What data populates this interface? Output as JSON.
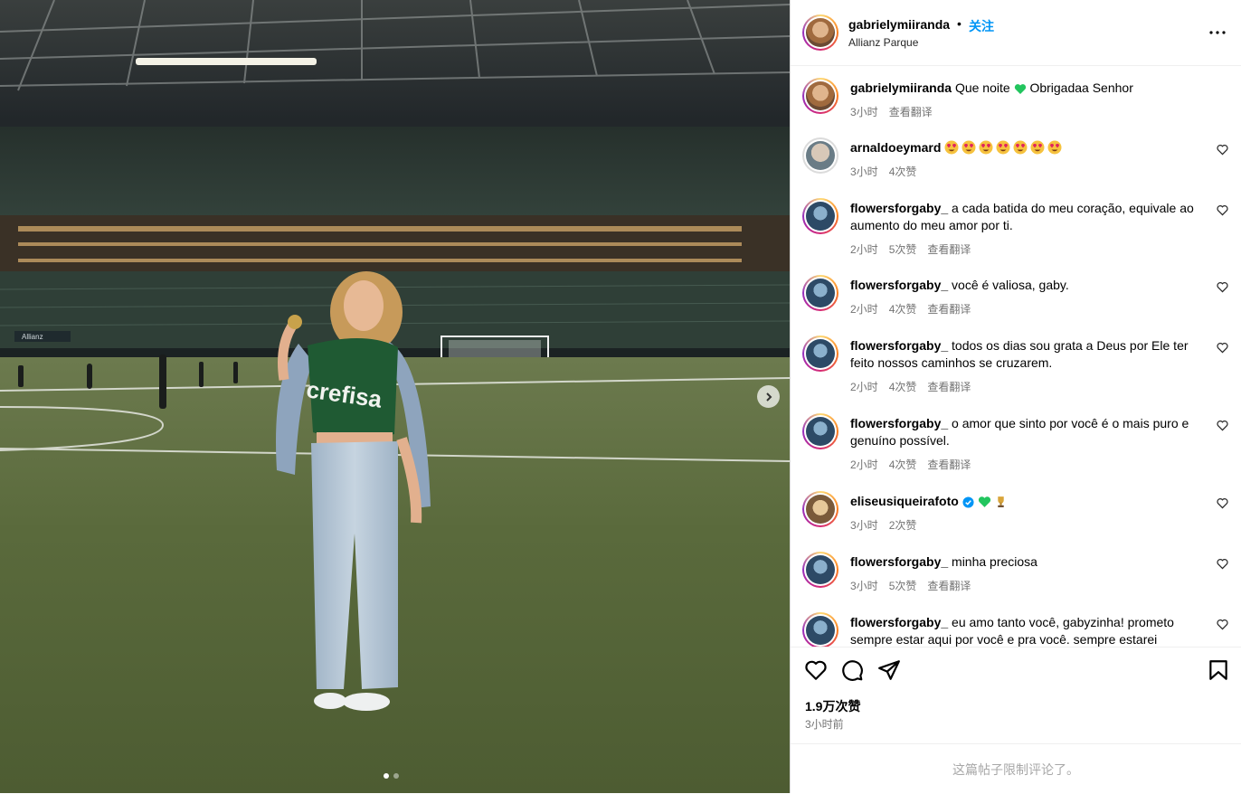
{
  "post": {
    "username": "gabrielymiiranda",
    "separator": "•",
    "follow_label": "关注",
    "location": "Allianz Parque",
    "likes": "1.9万次赞",
    "time": "3小时前",
    "restricted_notice": "这篇帖子限制评论了。"
  },
  "caption": {
    "username": "gabrielymiiranda",
    "text_a": "Que noite",
    "text_b": "Obrigadaa Senhor",
    "time": "3小时",
    "translate": "查看翻译"
  },
  "comments": [
    {
      "username": "arnaldoeymard",
      "text": "",
      "time": "3小时",
      "likes": "4次赞",
      "translate": ""
    },
    {
      "username": "flowersforgaby_",
      "text": "a cada batida do meu coração, equivale ao aumento do meu amor por ti.",
      "time": "2小时",
      "likes": "5次赞",
      "translate": "查看翻译"
    },
    {
      "username": "flowersforgaby_",
      "text": "você é valiosa, gaby.",
      "time": "2小时",
      "likes": "4次赞",
      "translate": "查看翻译"
    },
    {
      "username": "flowersforgaby_",
      "text": "todos os dias sou grata a Deus por Ele ter feito nossos caminhos se cruzarem.",
      "time": "2小时",
      "likes": "4次赞",
      "translate": "查看翻译"
    },
    {
      "username": "flowersforgaby_",
      "text": "o amor que sinto por você é o mais puro e genuíno possível.",
      "time": "2小时",
      "likes": "4次赞",
      "translate": "查看翻译"
    },
    {
      "username": "eliseusiqueirafoto",
      "text": "",
      "time": "3小时",
      "likes": "2次赞",
      "translate": ""
    },
    {
      "username": "flowersforgaby_",
      "text": "minha preciosa",
      "time": "3小时",
      "likes": "5次赞",
      "translate": "查看翻译"
    },
    {
      "username": "flowersforgaby_",
      "text": "eu amo tanto você, gabyzinha! prometo sempre estar aqui por você e pra você. sempre estarei presente",
      "time": "",
      "likes": "",
      "translate": ""
    }
  ],
  "photo": {
    "shirt_text": "crefisa",
    "banner_text": "Allianz"
  },
  "colors": {
    "accent": "#0095f6",
    "green_heart": "#22c55e",
    "verified": "#0095f6"
  },
  "icons": [
    "more-icon",
    "heart-icon",
    "comment-icon",
    "share-icon",
    "bookmark-icon",
    "chevron-right-icon",
    "verified-icon"
  ]
}
